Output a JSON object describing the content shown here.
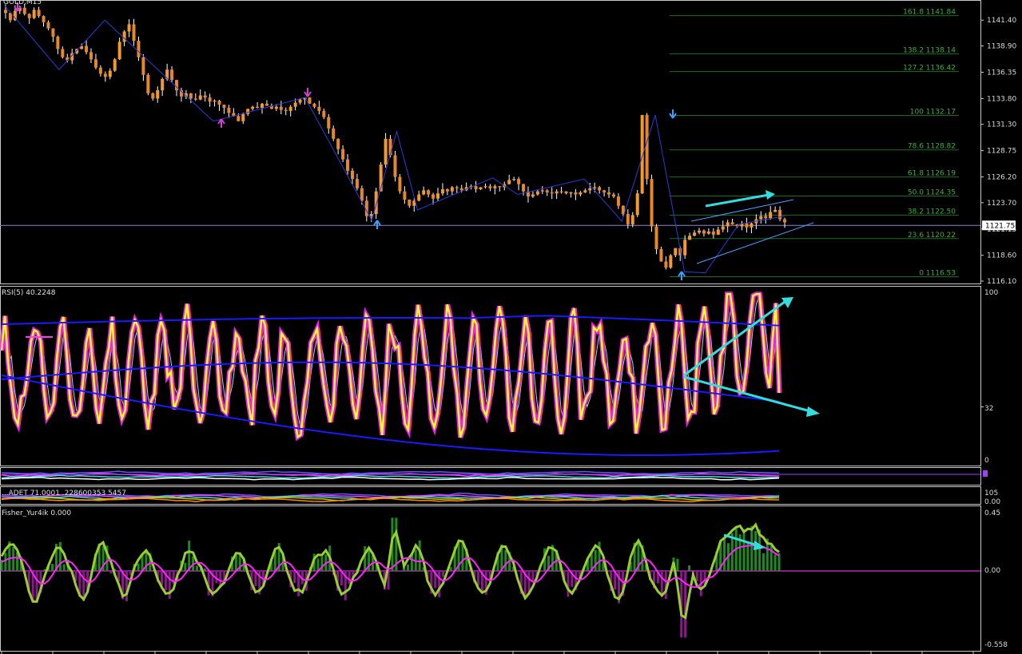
{
  "chart_data": [
    {
      "pane": "price",
      "type": "candlestick",
      "title": "GOLD,M15",
      "ylim": [
        1116.1,
        1143.2
      ],
      "y_ticks": [
        1141.4,
        1138.9,
        1136.35,
        1133.8,
        1131.3,
        1128.75,
        1126.2,
        1123.7,
        1121.15,
        1118.6,
        1116.1
      ],
      "current_price": "1121.75",
      "bars": 165,
      "closes": [
        1142.1,
        1141.4,
        1142.3,
        1142.6,
        1142.0,
        1141.6,
        1142.4,
        1141.8,
        1141.2,
        1140.6,
        1139.8,
        1138.6,
        1137.8,
        1137.5,
        1138.2,
        1138.6,
        1138.9,
        1138.3,
        1137.6,
        1136.8,
        1136.2,
        1135.9,
        1136.5,
        1137.6,
        1139.3,
        1140.3,
        1141.0,
        1139.4,
        1137.8,
        1136.1,
        1134.3,
        1133.8,
        1134.6,
        1135.7,
        1136.6,
        1135.6,
        1134.6,
        1134.0,
        1134.3,
        1133.8,
        1133.7,
        1134.1,
        1133.9,
        1133.5,
        1133.6,
        1133.2,
        1132.9,
        1132.4,
        1132.1,
        1131.6,
        1132.3,
        1132.8,
        1133.0,
        1132.9,
        1133.3,
        1133.1,
        1132.8,
        1133.0,
        1132.7,
        1132.6,
        1133.0,
        1133.4,
        1133.7,
        1133.9,
        1133.3,
        1133.0,
        1132.6,
        1132.0,
        1130.9,
        1129.9,
        1128.9,
        1127.9,
        1126.8,
        1126.0,
        1125.1,
        1123.9,
        1122.4,
        1122.6,
        1124.8,
        1127.4,
        1129.9,
        1128.3,
        1126.2,
        1124.8,
        1124.0,
        1123.4,
        1123.9,
        1124.5,
        1124.9,
        1124.5,
        1124.1,
        1124.6,
        1125.0,
        1124.8,
        1125.2,
        1125.1,
        1124.9,
        1125.2,
        1125.3,
        1125.0,
        1125.2,
        1125.3,
        1125.1,
        1125.3,
        1125.2,
        1125.5,
        1125.9,
        1126.0,
        1125.5,
        1124.8,
        1124.3,
        1124.5,
        1124.8,
        1124.9,
        1124.7,
        1124.6,
        1124.8,
        1124.8,
        1124.6,
        1124.7,
        1124.5,
        1124.7,
        1124.9,
        1125.1,
        1125.2,
        1124.9,
        1124.7,
        1124.5,
        1124.3,
        1123.4,
        1122.6,
        1121.6,
        1122.5,
        1124.6,
        1132.2,
        1126.0,
        1121.4,
        1119.2,
        1118.0,
        1117.4,
        1118.6,
        1119.3,
        1118.6,
        1120.1,
        1120.5,
        1120.8,
        1121.0,
        1120.7,
        1120.9,
        1120.6,
        1121.1,
        1121.4,
        1121.8,
        1121.6,
        1121.4,
        1121.7,
        1121.3,
        1121.7,
        1122.1,
        1122.4,
        1122.2,
        1122.8,
        1123.0,
        1122.1,
        1121.8
      ],
      "zigzag": [
        [
          0,
          1142.8
        ],
        [
          13,
          1136.6
        ],
        [
          24,
          1141.4
        ],
        [
          50,
          1131.6
        ],
        [
          72,
          1133.9
        ],
        [
          88,
          1122.0
        ],
        [
          94,
          1130.6
        ],
        [
          99,
          1123.0
        ],
        [
          117,
          1126.1
        ],
        [
          123,
          1124.5
        ],
        [
          139,
          1126.0
        ],
        [
          148,
          1121.9
        ],
        [
          156,
          1132.2
        ],
        [
          163,
          1117.0
        ],
        [
          168,
          1116.9
        ],
        [
          176,
          1121.6
        ],
        [
          187,
          1122.4
        ]
      ],
      "fibonacci": [
        {
          "label": "161.8 1141.84",
          "price": 1141.84
        },
        {
          "label": "138.2 1138.14",
          "price": 1138.14
        },
        {
          "label": "127.2 1136.42",
          "price": 1136.42
        },
        {
          "label": "100 1132.17",
          "price": 1132.17
        },
        {
          "label": "78.6 1128.82",
          "price": 1128.82
        },
        {
          "label": "61.8 1126.19",
          "price": 1126.19
        },
        {
          "label": "50.0 1124.35",
          "price": 1124.35
        },
        {
          "label": "38.2 1122.50",
          "price": 1122.5
        },
        {
          "label": "23.6 1120.22",
          "price": 1120.22
        },
        {
          "label": "0 1116.53",
          "price": 1116.53
        }
      ],
      "horizontal_line": 1121.5
    },
    {
      "pane": "rsi",
      "type": "line",
      "title": "RSI(5) 40.2248",
      "ylim": [
        0,
        100
      ],
      "y_ticks": [
        "100",
        "32",
        "0"
      ]
    },
    {
      "pane": "band1",
      "type": "line",
      "title": ""
    },
    {
      "pane": "band2",
      "type": "line",
      "title": "...ADET 71.0001 .228600353 5457",
      "y_ticks": [
        "105",
        "0.00"
      ]
    },
    {
      "pane": "fisher",
      "type": "bar",
      "title": "Fisher_Yur4ik 0.000",
      "ylim": [
        -0.558,
        0.45
      ],
      "y_ticks": [
        "0.45",
        "0.00",
        "-0.558"
      ]
    }
  ],
  "colors": {
    "bull": "#f29a2e",
    "bear": "#f29a2e",
    "wick": "#ffffff",
    "zigzag": "#2a3cd8",
    "fib": "#1c6e1c",
    "rsi": "#ffff22",
    "rsi_glow": "#ff22ff",
    "band": "#1a1aff",
    "cyan": "#33dddd",
    "fisher_pos": "#1f8a1f",
    "fisher_neg": "#8a1a8a",
    "fisher_line": "#9acd32",
    "signal": "#ff22ff",
    "grid_border": "#c8c8c8"
  },
  "arrows": [
    "arrow-up-icon",
    "arrow-down-icon"
  ]
}
